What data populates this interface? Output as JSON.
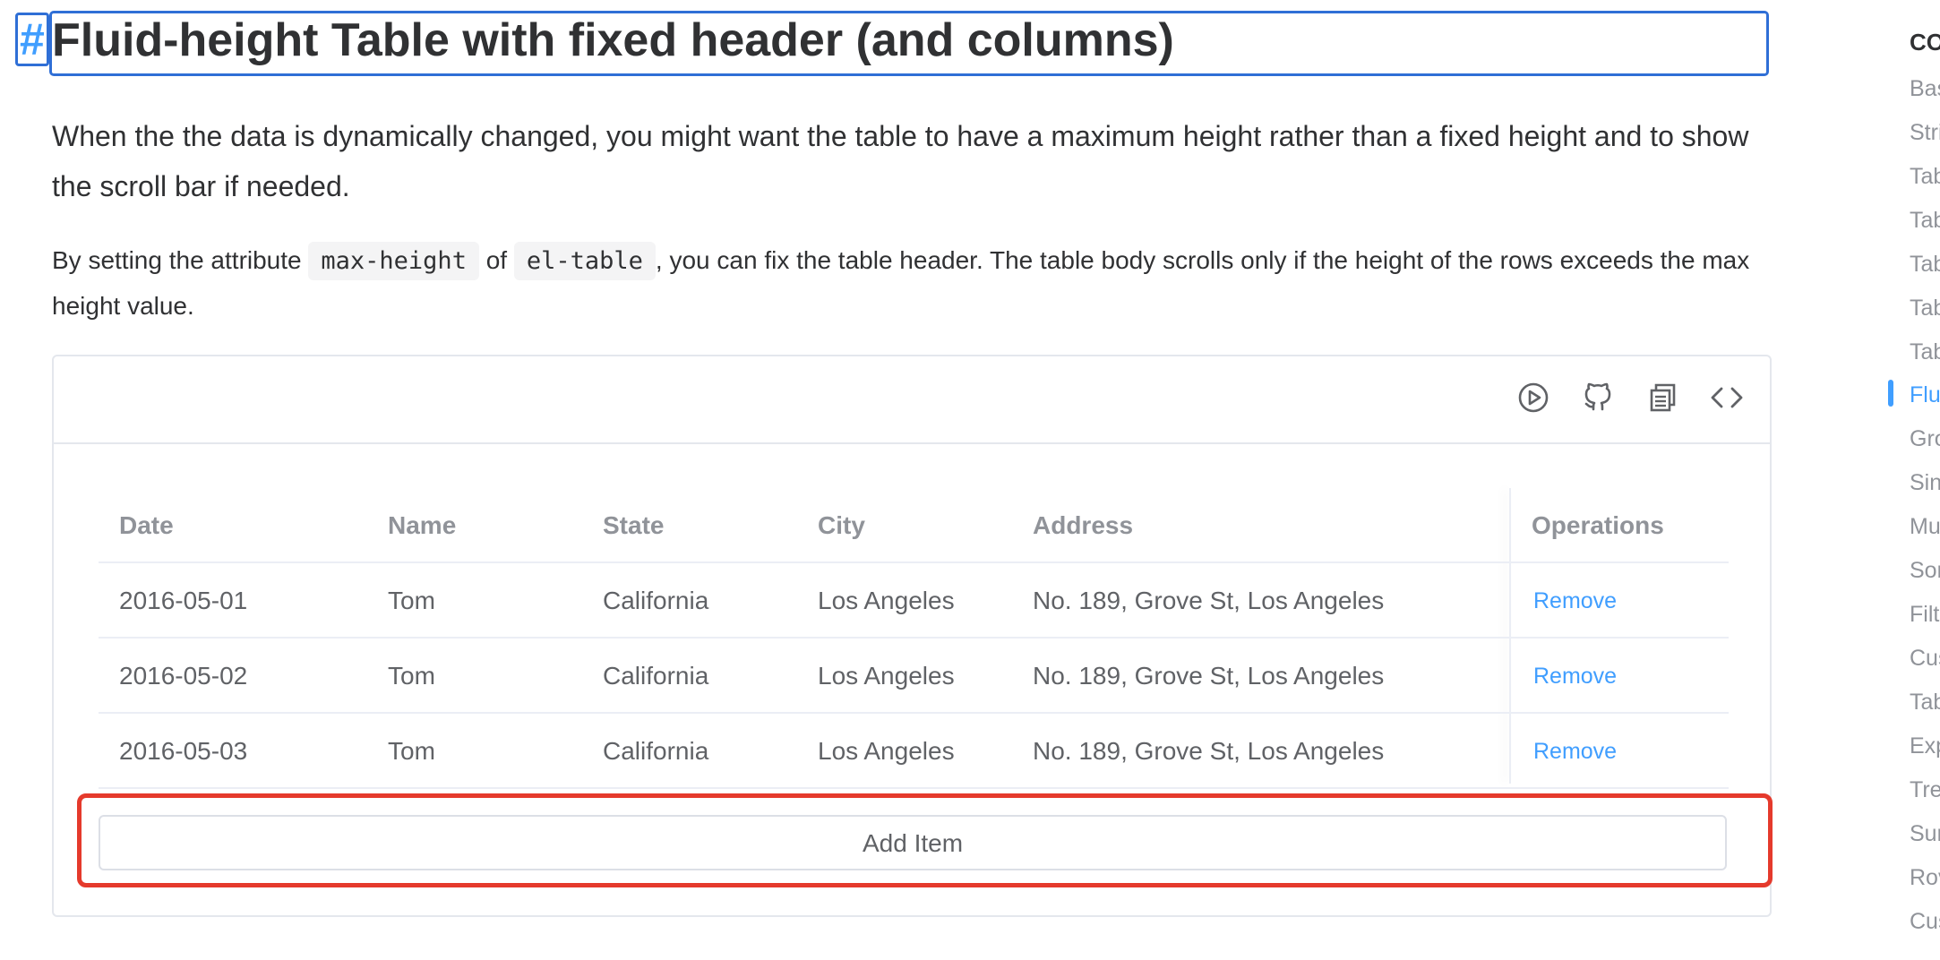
{
  "heading": {
    "anchor": "#",
    "title": "Fluid-height Table with fixed header (and columns)"
  },
  "intro": {
    "text": "When the the data is dynamically changed, you might want the table to have a maximum height rather than a fixed height and to show the scroll bar if needed."
  },
  "attribute_note": {
    "prefix": "By setting the attribute ",
    "code1": "max-height",
    "middle": " of ",
    "code2": "el-table",
    "suffix": ", you can fix the table header. The table body scrolls only if the height of the rows exceeds the max height value."
  },
  "toolbar": {
    "icons": [
      "play-circle-icon",
      "github-icon",
      "copy-icon",
      "code-icon"
    ]
  },
  "table": {
    "headers": [
      "Date",
      "Name",
      "State",
      "City",
      "Address",
      "Operations"
    ],
    "rows": [
      {
        "date": "2016-05-01",
        "name": "Tom",
        "state": "California",
        "city": "Los Angeles",
        "address": "No. 189, Grove St, Los Angeles",
        "action": "Remove"
      },
      {
        "date": "2016-05-02",
        "name": "Tom",
        "state": "California",
        "city": "Los Angeles",
        "address": "No. 189, Grove St, Los Angeles",
        "action": "Remove"
      },
      {
        "date": "2016-05-03",
        "name": "Tom",
        "state": "California",
        "city": "Los Angeles",
        "address": "No. 189, Grove St, Los Angeles",
        "action": "Remove"
      }
    ]
  },
  "add_button": {
    "label": "Add Item"
  },
  "toc": {
    "title": "CO",
    "items": [
      "Bas",
      "Stri",
      "Tab",
      "Tab",
      "Tab",
      "Tab",
      "Tab",
      "Flui",
      "Gro",
      "Sin",
      "Mu",
      "Sor",
      "Filt",
      "Cus",
      "Tab",
      "Exp",
      "Tre",
      "Sur",
      "Rov",
      "Cus"
    ],
    "active_index": 7
  },
  "colors": {
    "accent": "#409eff",
    "highlight": "#e53a2c",
    "focus_border": "#2f6fd6"
  }
}
